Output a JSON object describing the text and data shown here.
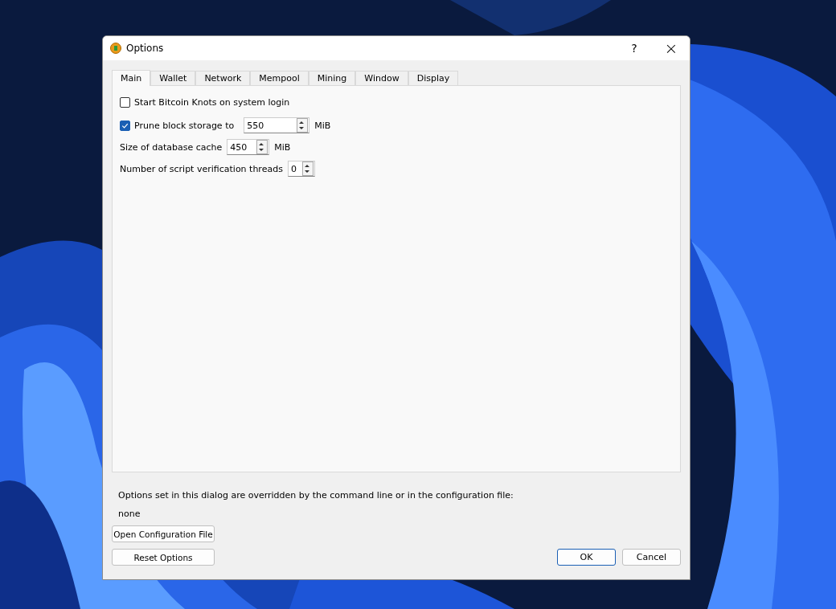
{
  "window": {
    "title": "Options",
    "help": "?",
    "close": "×"
  },
  "tabs": [
    {
      "label": "Main",
      "selected": true
    },
    {
      "label": "Wallet",
      "selected": false
    },
    {
      "label": "Network",
      "selected": false
    },
    {
      "label": "Mempool",
      "selected": false
    },
    {
      "label": "Mining",
      "selected": false
    },
    {
      "label": "Window",
      "selected": false
    },
    {
      "label": "Display",
      "selected": false
    }
  ],
  "settings": [
    {
      "kind": "checkbox",
      "label": "Start Bitcoin Knots on system login",
      "checked": false
    },
    {
      "kind": "checkbox_spin",
      "label": "Prune block storage to",
      "checked": true,
      "value": "550",
      "unit": "MiB"
    },
    {
      "kind": "spin",
      "label": "Size of database cache",
      "value": "450",
      "unit": "MiB"
    },
    {
      "kind": "spin",
      "label": "Number of script verification threads",
      "value": "0"
    }
  ],
  "override_note": "Options set in this dialog are overridden by the command line or in the configuration file:",
  "override_value": "none",
  "buttons": {
    "open_config": "Open Configuration File",
    "reset": "Reset Options",
    "ok": "OK",
    "cancel": "Cancel"
  }
}
